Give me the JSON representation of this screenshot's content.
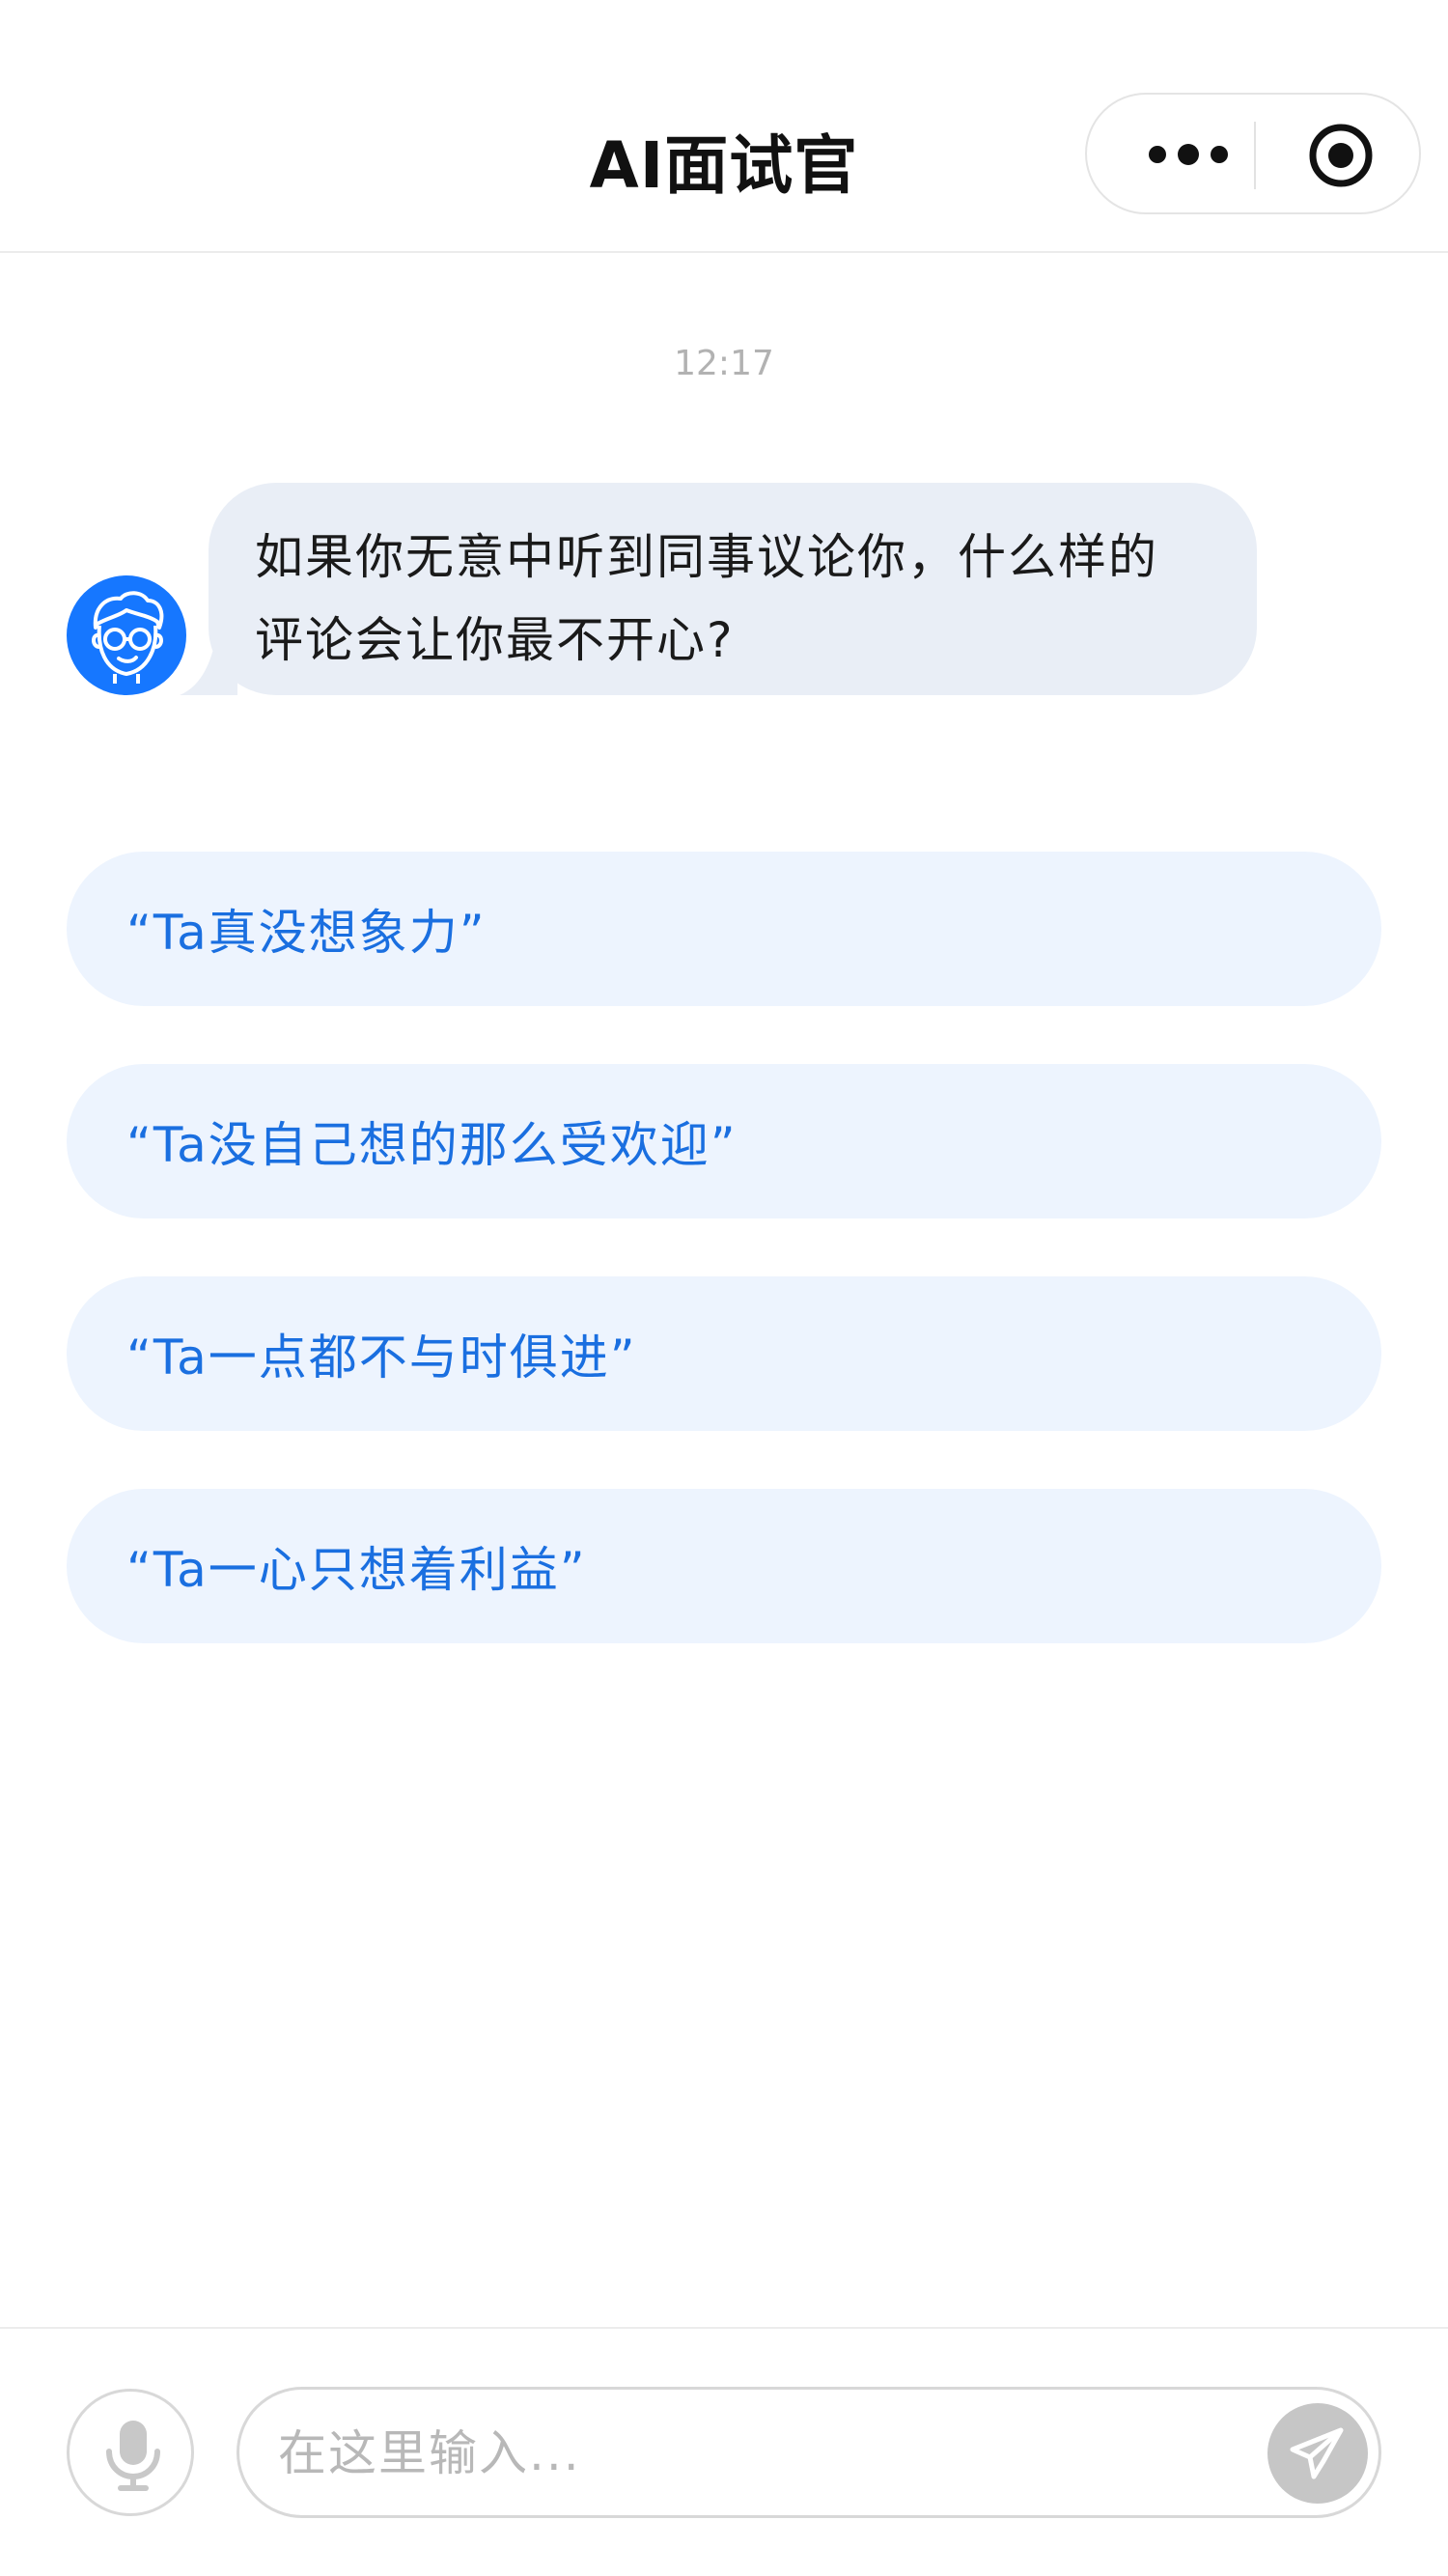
{
  "header": {
    "title": "AI面试官",
    "more_icon": "more-dots-icon",
    "target_icon": "target-circle-icon"
  },
  "chat": {
    "timestamp": "12:17",
    "avatar_icon": "interviewer-avatar-icon",
    "message_line1": "如果你无意中听到同事议论你，什么样的",
    "message_line2": "评论会让你最不开心?"
  },
  "options": [
    {
      "label": "“Ta真没想象力”"
    },
    {
      "label": "“Ta没自己想的那么受欢迎”"
    },
    {
      "label": "“Ta一点都不与时俱进”"
    },
    {
      "label": "“Ta一心只想着利益”"
    }
  ],
  "input": {
    "placeholder": "在这里输入...",
    "value": ""
  },
  "colors": {
    "accent": "#1677ff",
    "option_text": "#1a6fe0",
    "option_bg": "#edf4fe",
    "bubble_bg": "#e9eef6",
    "send_bg": "#c6c6c6"
  },
  "icons": {
    "mic": "microphone-icon",
    "send": "paper-plane-icon"
  }
}
